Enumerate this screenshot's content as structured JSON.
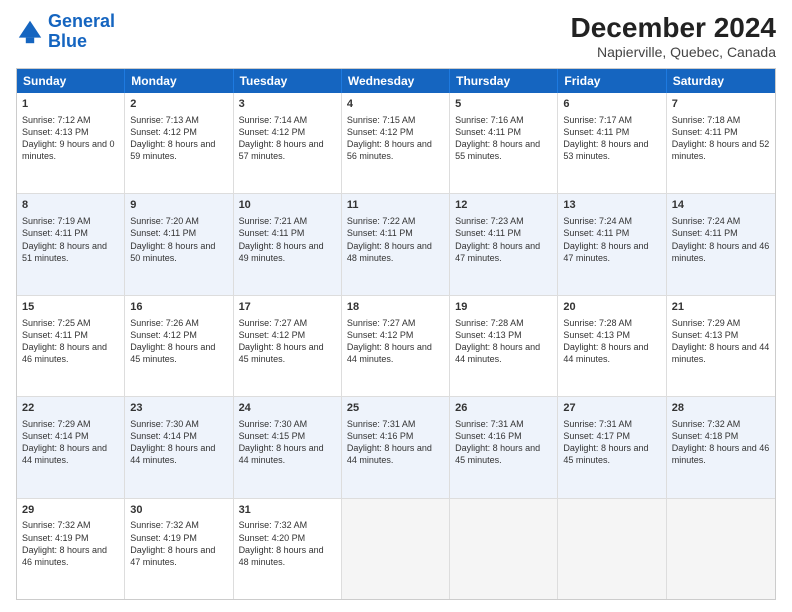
{
  "logo": {
    "line1": "General",
    "line2": "Blue"
  },
  "title": "December 2024",
  "subtitle": "Napierville, Quebec, Canada",
  "days_of_week": [
    "Sunday",
    "Monday",
    "Tuesday",
    "Wednesday",
    "Thursday",
    "Friday",
    "Saturday"
  ],
  "weeks": [
    [
      {
        "day": "1",
        "sunrise": "Sunrise: 7:12 AM",
        "sunset": "Sunset: 4:13 PM",
        "daylight": "Daylight: 9 hours and 0 minutes."
      },
      {
        "day": "2",
        "sunrise": "Sunrise: 7:13 AM",
        "sunset": "Sunset: 4:12 PM",
        "daylight": "Daylight: 8 hours and 59 minutes."
      },
      {
        "day": "3",
        "sunrise": "Sunrise: 7:14 AM",
        "sunset": "Sunset: 4:12 PM",
        "daylight": "Daylight: 8 hours and 57 minutes."
      },
      {
        "day": "4",
        "sunrise": "Sunrise: 7:15 AM",
        "sunset": "Sunset: 4:12 PM",
        "daylight": "Daylight: 8 hours and 56 minutes."
      },
      {
        "day": "5",
        "sunrise": "Sunrise: 7:16 AM",
        "sunset": "Sunset: 4:11 PM",
        "daylight": "Daylight: 8 hours and 55 minutes."
      },
      {
        "day": "6",
        "sunrise": "Sunrise: 7:17 AM",
        "sunset": "Sunset: 4:11 PM",
        "daylight": "Daylight: 8 hours and 53 minutes."
      },
      {
        "day": "7",
        "sunrise": "Sunrise: 7:18 AM",
        "sunset": "Sunset: 4:11 PM",
        "daylight": "Daylight: 8 hours and 52 minutes."
      }
    ],
    [
      {
        "day": "8",
        "sunrise": "Sunrise: 7:19 AM",
        "sunset": "Sunset: 4:11 PM",
        "daylight": "Daylight: 8 hours and 51 minutes."
      },
      {
        "day": "9",
        "sunrise": "Sunrise: 7:20 AM",
        "sunset": "Sunset: 4:11 PM",
        "daylight": "Daylight: 8 hours and 50 minutes."
      },
      {
        "day": "10",
        "sunrise": "Sunrise: 7:21 AM",
        "sunset": "Sunset: 4:11 PM",
        "daylight": "Daylight: 8 hours and 49 minutes."
      },
      {
        "day": "11",
        "sunrise": "Sunrise: 7:22 AM",
        "sunset": "Sunset: 4:11 PM",
        "daylight": "Daylight: 8 hours and 48 minutes."
      },
      {
        "day": "12",
        "sunrise": "Sunrise: 7:23 AM",
        "sunset": "Sunset: 4:11 PM",
        "daylight": "Daylight: 8 hours and 47 minutes."
      },
      {
        "day": "13",
        "sunrise": "Sunrise: 7:24 AM",
        "sunset": "Sunset: 4:11 PM",
        "daylight": "Daylight: 8 hours and 47 minutes."
      },
      {
        "day": "14",
        "sunrise": "Sunrise: 7:24 AM",
        "sunset": "Sunset: 4:11 PM",
        "daylight": "Daylight: 8 hours and 46 minutes."
      }
    ],
    [
      {
        "day": "15",
        "sunrise": "Sunrise: 7:25 AM",
        "sunset": "Sunset: 4:11 PM",
        "daylight": "Daylight: 8 hours and 46 minutes."
      },
      {
        "day": "16",
        "sunrise": "Sunrise: 7:26 AM",
        "sunset": "Sunset: 4:12 PM",
        "daylight": "Daylight: 8 hours and 45 minutes."
      },
      {
        "day": "17",
        "sunrise": "Sunrise: 7:27 AM",
        "sunset": "Sunset: 4:12 PM",
        "daylight": "Daylight: 8 hours and 45 minutes."
      },
      {
        "day": "18",
        "sunrise": "Sunrise: 7:27 AM",
        "sunset": "Sunset: 4:12 PM",
        "daylight": "Daylight: 8 hours and 44 minutes."
      },
      {
        "day": "19",
        "sunrise": "Sunrise: 7:28 AM",
        "sunset": "Sunset: 4:13 PM",
        "daylight": "Daylight: 8 hours and 44 minutes."
      },
      {
        "day": "20",
        "sunrise": "Sunrise: 7:28 AM",
        "sunset": "Sunset: 4:13 PM",
        "daylight": "Daylight: 8 hours and 44 minutes."
      },
      {
        "day": "21",
        "sunrise": "Sunrise: 7:29 AM",
        "sunset": "Sunset: 4:13 PM",
        "daylight": "Daylight: 8 hours and 44 minutes."
      }
    ],
    [
      {
        "day": "22",
        "sunrise": "Sunrise: 7:29 AM",
        "sunset": "Sunset: 4:14 PM",
        "daylight": "Daylight: 8 hours and 44 minutes."
      },
      {
        "day": "23",
        "sunrise": "Sunrise: 7:30 AM",
        "sunset": "Sunset: 4:14 PM",
        "daylight": "Daylight: 8 hours and 44 minutes."
      },
      {
        "day": "24",
        "sunrise": "Sunrise: 7:30 AM",
        "sunset": "Sunset: 4:15 PM",
        "daylight": "Daylight: 8 hours and 44 minutes."
      },
      {
        "day": "25",
        "sunrise": "Sunrise: 7:31 AM",
        "sunset": "Sunset: 4:16 PM",
        "daylight": "Daylight: 8 hours and 44 minutes."
      },
      {
        "day": "26",
        "sunrise": "Sunrise: 7:31 AM",
        "sunset": "Sunset: 4:16 PM",
        "daylight": "Daylight: 8 hours and 45 minutes."
      },
      {
        "day": "27",
        "sunrise": "Sunrise: 7:31 AM",
        "sunset": "Sunset: 4:17 PM",
        "daylight": "Daylight: 8 hours and 45 minutes."
      },
      {
        "day": "28",
        "sunrise": "Sunrise: 7:32 AM",
        "sunset": "Sunset: 4:18 PM",
        "daylight": "Daylight: 8 hours and 46 minutes."
      }
    ],
    [
      {
        "day": "29",
        "sunrise": "Sunrise: 7:32 AM",
        "sunset": "Sunset: 4:19 PM",
        "daylight": "Daylight: 8 hours and 46 minutes."
      },
      {
        "day": "30",
        "sunrise": "Sunrise: 7:32 AM",
        "sunset": "Sunset: 4:19 PM",
        "daylight": "Daylight: 8 hours and 47 minutes."
      },
      {
        "day": "31",
        "sunrise": "Sunrise: 7:32 AM",
        "sunset": "Sunset: 4:20 PM",
        "daylight": "Daylight: 8 hours and 48 minutes."
      },
      null,
      null,
      null,
      null
    ]
  ]
}
